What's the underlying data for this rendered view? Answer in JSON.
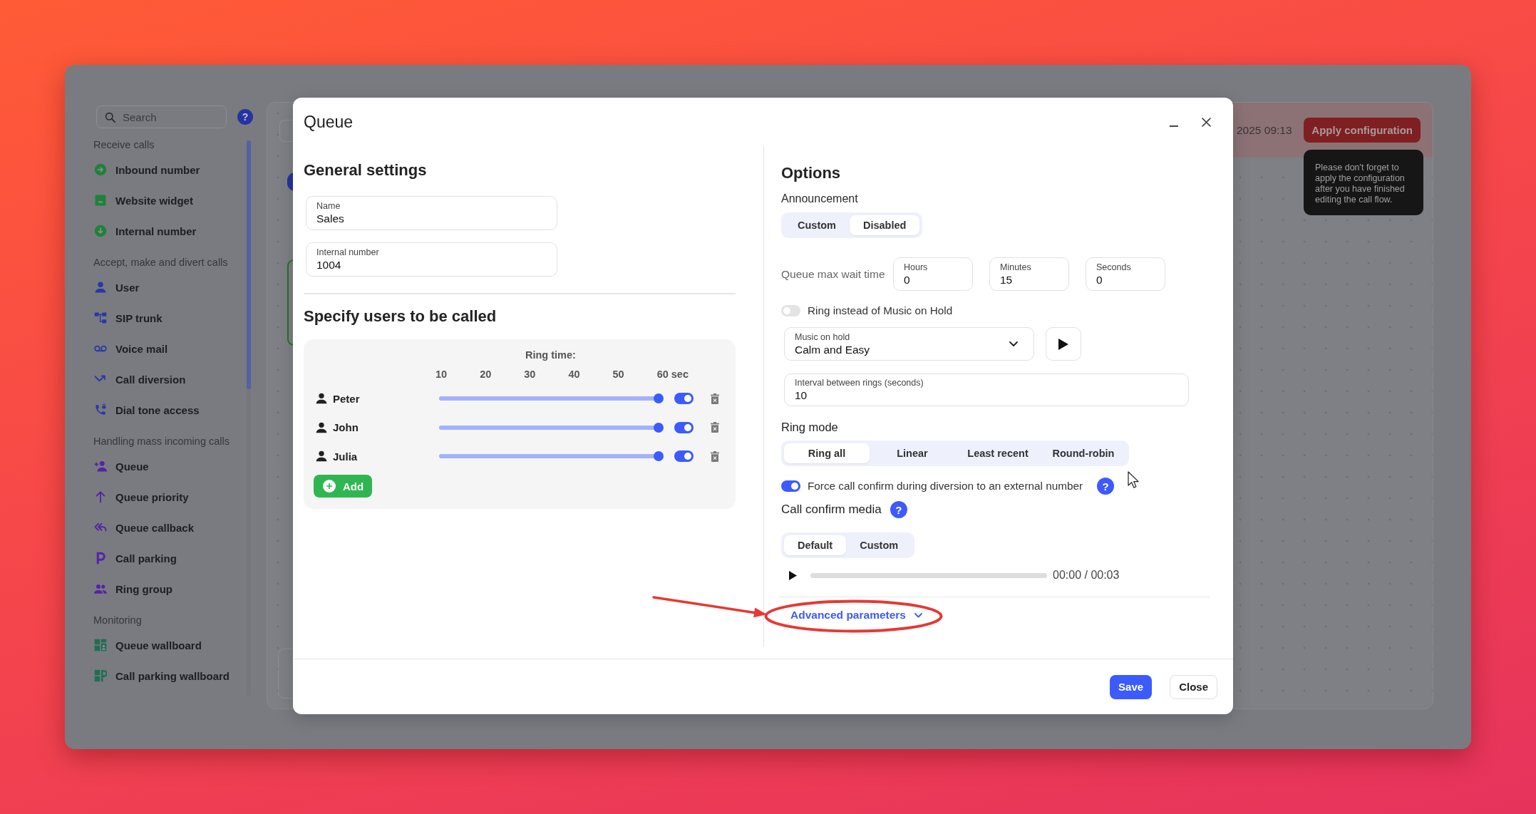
{
  "sidebar": {
    "search": {
      "placeholder": "Search"
    },
    "help": "?",
    "sections": [
      {
        "title": "Receive calls",
        "items": [
          {
            "label": "Inbound number",
            "kind": "inbound"
          },
          {
            "label": "Website widget",
            "kind": "widget"
          },
          {
            "label": "Internal number",
            "kind": "internal"
          }
        ]
      },
      {
        "title": "Accept, make and divert calls",
        "items": [
          {
            "label": "User",
            "kind": "user"
          },
          {
            "label": "SIP trunk",
            "kind": "trunk"
          },
          {
            "label": "Voice mail",
            "kind": "voicemail"
          },
          {
            "label": "Call diversion",
            "kind": "diversion"
          },
          {
            "label": "Dial tone access",
            "kind": "dialtone"
          }
        ]
      },
      {
        "title": "Handling mass incoming calls",
        "items": [
          {
            "label": "Queue",
            "kind": "queue"
          },
          {
            "label": "Queue priority",
            "kind": "priority"
          },
          {
            "label": "Queue callback",
            "kind": "callback"
          },
          {
            "label": "Call parking",
            "kind": "parking"
          },
          {
            "label": "Ring group",
            "kind": "ringgroup"
          }
        ]
      },
      {
        "title": "Monitoring",
        "items": [
          {
            "label": "Queue wallboard",
            "kind": "wallboard"
          },
          {
            "label": "Call parking wallboard",
            "kind": "parkingboard"
          }
        ]
      }
    ]
  },
  "canvas": {
    "banner": {
      "timestamp": "2025 09:13",
      "apply_button": "Apply configuration"
    },
    "tooltip": "Please don't forget to apply the configuration after you have finished editing the call flow."
  },
  "dialog": {
    "title": "Queue",
    "general": {
      "title": "General settings",
      "fields": [
        {
          "label": "Name",
          "value": "Sales"
        },
        {
          "label": "Internal number",
          "value": "1004"
        }
      ]
    },
    "users": {
      "title": "Specify users to be called",
      "ring_time_label": "Ring time:",
      "ticks": [
        "10",
        "20",
        "30",
        "40",
        "50",
        "60 sec"
      ],
      "rows": [
        {
          "name": "Peter",
          "level": 1,
          "on": true
        },
        {
          "name": "John",
          "level": 1,
          "on": true
        },
        {
          "name": "Julia",
          "level": 1,
          "on": true
        }
      ],
      "add_button": "Add"
    },
    "options": {
      "title": "Options",
      "announcement": {
        "label": "Announcement",
        "options": [
          {
            "label": "Custom",
            "selected": false
          },
          {
            "label": "Disabled",
            "selected": true
          }
        ]
      },
      "max_wait": {
        "label": "Queue max wait time",
        "fields": [
          {
            "label": "Hours",
            "value": "0"
          },
          {
            "label": "Minutes",
            "value": "15"
          },
          {
            "label": "Seconds",
            "value": "0"
          }
        ]
      },
      "ring_instead": {
        "label": "Ring instead of Music on Hold",
        "on": false
      },
      "music_on_hold": {
        "label": "Music on hold",
        "value": "Calm and Easy"
      },
      "interval": {
        "label": "Interval between rings (seconds)",
        "value": "10"
      },
      "ring_mode": {
        "label": "Ring mode",
        "options": [
          {
            "label": "Ring all",
            "selected": true
          },
          {
            "label": "Linear",
            "selected": false
          },
          {
            "label": "Least recent",
            "selected": false
          },
          {
            "label": "Round-robin",
            "selected": false
          }
        ]
      },
      "force_confirm": {
        "label": "Force call confirm during diversion to an external number",
        "on": true,
        "help": "?"
      },
      "confirm_media": {
        "label": "Call confirm media",
        "help": "?",
        "options": [
          {
            "label": "Default",
            "selected": true
          },
          {
            "label": "Custom",
            "selected": false
          }
        ]
      },
      "player": {
        "time": "00:00 / 00:03"
      },
      "advanced": {
        "label": "Advanced parameters",
        "expanded": false
      }
    },
    "buttons": [
      {
        "label": "Save",
        "kind": "primary"
      },
      {
        "label": "Close",
        "kind": "secondary"
      }
    ]
  }
}
